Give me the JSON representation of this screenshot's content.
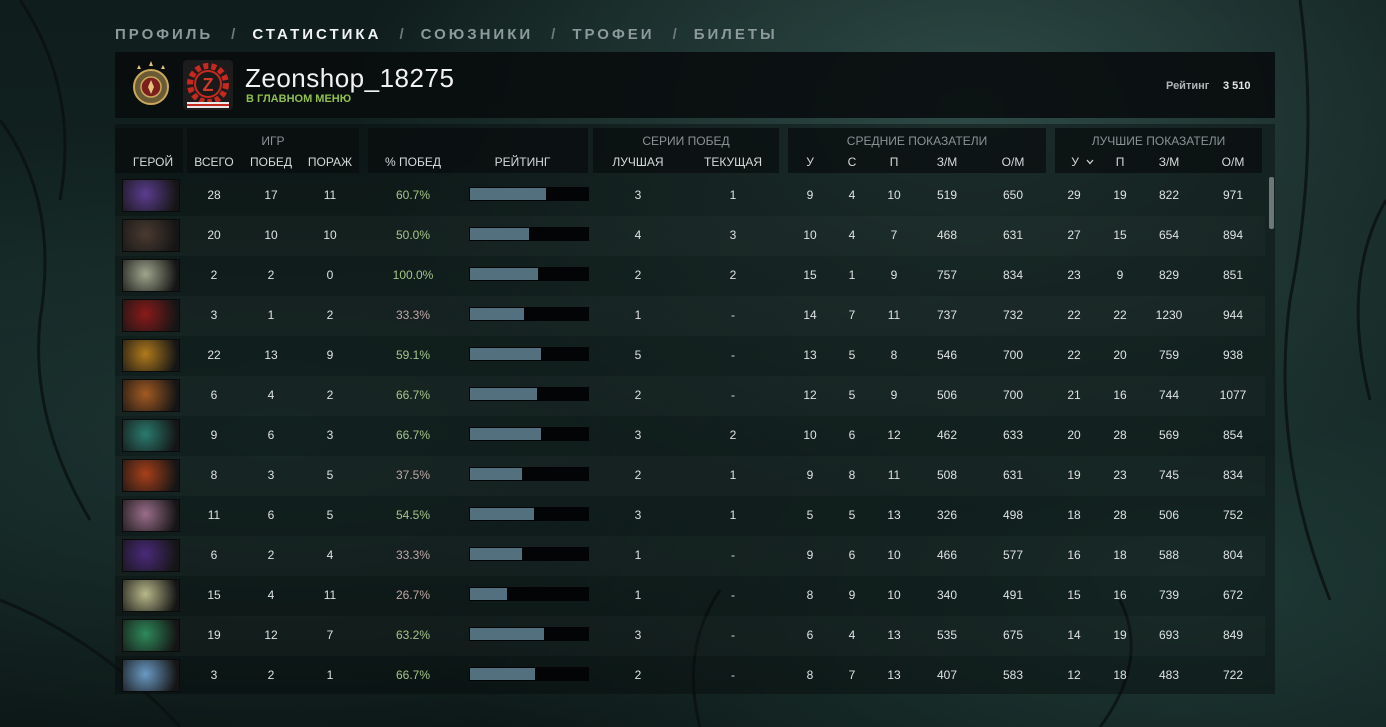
{
  "nav": {
    "tabs": [
      "ПРОФИЛЬ",
      "СТАТИСТИКА",
      "СОЮЗНИКИ",
      "ТРОФЕИ",
      "БИЛЕТЫ"
    ],
    "active": "СТАТИСТИКА",
    "separator": "/"
  },
  "profile": {
    "name": "Zeonshop_18275",
    "status": "В ГЛАВНОМ МЕНЮ",
    "rating_label": "Рейтинг",
    "rating_value": "3 510",
    "avatar_letter": "Z"
  },
  "table": {
    "groups": {
      "games": "ИГР",
      "streaks": "СЕРИИ ПОБЕД",
      "avg": "СРЕДНИЕ ПОКАЗАТЕЛИ",
      "best": "ЛУЧШИЕ ПОКАЗАТЕЛИ"
    },
    "columns": {
      "hero": "ГЕРОЙ",
      "total": "ВСЕГО",
      "wins": "ПОБЕД",
      "losses": "ПОРАЖ",
      "winrate": "% ПОБЕД",
      "rating": "РЕЙТИНГ",
      "best_streak": "ЛУЧШАЯ",
      "cur_streak": "ТЕКУЩАЯ",
      "avg_k": "У",
      "avg_d": "С",
      "avg_a": "П",
      "avg_gpm": "З/М",
      "avg_xpm": "О/М",
      "best_k": "У",
      "best_a": "П",
      "best_gpm": "З/М",
      "best_xpm": "О/М"
    },
    "sort_icon": "chevron-down-icon",
    "rows": [
      {
        "hero": "faceless-purple",
        "total": "28",
        "wins": "17",
        "losses": "11",
        "winrate": "60.7%",
        "rating_pct": 0.64,
        "best_streak": "3",
        "cur_streak": "1",
        "avg_k": "9",
        "avg_d": "4",
        "avg_a": "10",
        "avg_gpm": "519",
        "avg_xpm": "650",
        "best_k": "29",
        "best_a": "19",
        "best_gpm": "822",
        "best_xpm": "971"
      },
      {
        "hero": "beast-brown",
        "total": "20",
        "wins": "10",
        "losses": "10",
        "winrate": "50.0%",
        "rating_pct": 0.5,
        "best_streak": "4",
        "cur_streak": "3",
        "avg_k": "10",
        "avg_d": "4",
        "avg_a": "7",
        "avg_gpm": "468",
        "avg_xpm": "631",
        "best_k": "27",
        "best_a": "15",
        "best_gpm": "654",
        "best_xpm": "894"
      },
      {
        "hero": "pale-blade",
        "total": "2",
        "wins": "2",
        "losses": "0",
        "winrate": "100.0%",
        "rating_pct": 0.58,
        "best_streak": "2",
        "cur_streak": "2",
        "avg_k": "15",
        "avg_d": "1",
        "avg_a": "9",
        "avg_gpm": "757",
        "avg_xpm": "834",
        "best_k": "23",
        "best_a": "9",
        "best_gpm": "829",
        "best_xpm": "851"
      },
      {
        "hero": "red-queen",
        "total": "3",
        "wins": "1",
        "losses": "2",
        "winrate": "33.3%",
        "rating_pct": 0.46,
        "best_streak": "1",
        "cur_streak": "-",
        "avg_k": "14",
        "avg_d": "7",
        "avg_a": "11",
        "avg_gpm": "737",
        "avg_xpm": "732",
        "best_k": "22",
        "best_a": "22",
        "best_gpm": "1230",
        "best_xpm": "944"
      },
      {
        "hero": "golden-king",
        "total": "22",
        "wins": "13",
        "losses": "9",
        "winrate": "59.1%",
        "rating_pct": 0.6,
        "best_streak": "5",
        "cur_streak": "-",
        "avg_k": "13",
        "avg_d": "5",
        "avg_a": "8",
        "avg_gpm": "546",
        "avg_xpm": "700",
        "best_k": "22",
        "best_a": "20",
        "best_gpm": "759",
        "best_xpm": "938"
      },
      {
        "hero": "monkey-gold",
        "total": "6",
        "wins": "4",
        "losses": "2",
        "winrate": "66.7%",
        "rating_pct": 0.57,
        "best_streak": "2",
        "cur_streak": "-",
        "avg_k": "12",
        "avg_d": "5",
        "avg_a": "9",
        "avg_gpm": "506",
        "avg_xpm": "700",
        "best_k": "21",
        "best_a": "16",
        "best_gpm": "744",
        "best_xpm": "1077"
      },
      {
        "hero": "teal-warrior",
        "total": "9",
        "wins": "6",
        "losses": "3",
        "winrate": "66.7%",
        "rating_pct": 0.6,
        "best_streak": "3",
        "cur_streak": "2",
        "avg_k": "10",
        "avg_d": "6",
        "avg_a": "12",
        "avg_gpm": "462",
        "avg_xpm": "633",
        "best_k": "20",
        "best_a": "28",
        "best_gpm": "569",
        "best_xpm": "854"
      },
      {
        "hero": "ember-orange",
        "total": "8",
        "wins": "3",
        "losses": "5",
        "winrate": "37.5%",
        "rating_pct": 0.44,
        "best_streak": "2",
        "cur_streak": "1",
        "avg_k": "9",
        "avg_d": "8",
        "avg_a": "11",
        "avg_gpm": "508",
        "avg_xpm": "631",
        "best_k": "19",
        "best_a": "23",
        "best_gpm": "745",
        "best_xpm": "834"
      },
      {
        "hero": "violet-invoker",
        "total": "11",
        "wins": "6",
        "losses": "5",
        "winrate": "54.5%",
        "rating_pct": 0.54,
        "best_streak": "3",
        "cur_streak": "1",
        "avg_k": "5",
        "avg_d": "5",
        "avg_a": "13",
        "avg_gpm": "326",
        "avg_xpm": "498",
        "best_k": "18",
        "best_a": "28",
        "best_gpm": "506",
        "best_xpm": "752"
      },
      {
        "hero": "void-purple",
        "total": "6",
        "wins": "2",
        "losses": "4",
        "winrate": "33.3%",
        "rating_pct": 0.44,
        "best_streak": "1",
        "cur_streak": "-",
        "avg_k": "9",
        "avg_d": "6",
        "avg_a": "10",
        "avg_gpm": "466",
        "avg_xpm": "577",
        "best_k": "16",
        "best_a": "18",
        "best_gpm": "588",
        "best_xpm": "804"
      },
      {
        "hero": "sky-light",
        "total": "15",
        "wins": "4",
        "losses": "11",
        "winrate": "26.7%",
        "rating_pct": 0.31,
        "best_streak": "1",
        "cur_streak": "-",
        "avg_k": "8",
        "avg_d": "9",
        "avg_a": "10",
        "avg_gpm": "340",
        "avg_xpm": "491",
        "best_k": "15",
        "best_a": "16",
        "best_gpm": "739",
        "best_xpm": "672"
      },
      {
        "hero": "jade-spirit",
        "total": "19",
        "wins": "12",
        "losses": "7",
        "winrate": "63.2%",
        "rating_pct": 0.63,
        "best_streak": "3",
        "cur_streak": "-",
        "avg_k": "6",
        "avg_d": "4",
        "avg_a": "13",
        "avg_gpm": "535",
        "avg_xpm": "675",
        "best_k": "14",
        "best_a": "19",
        "best_gpm": "693",
        "best_xpm": "849"
      },
      {
        "hero": "frost-zeus",
        "total": "3",
        "wins": "2",
        "losses": "1",
        "winrate": "66.7%",
        "rating_pct": 0.55,
        "best_streak": "2",
        "cur_streak": "-",
        "avg_k": "8",
        "avg_d": "7",
        "avg_a": "13",
        "avg_gpm": "407",
        "avg_xpm": "583",
        "best_k": "12",
        "best_a": "18",
        "best_gpm": "483",
        "best_xpm": "722"
      }
    ],
    "hero_colors": [
      "#5c3d8f",
      "#4a3a30",
      "#9fa58c",
      "#8a1a1a",
      "#b07a1c",
      "#a35a22",
      "#2a7a6e",
      "#a8401a",
      "#9a6d8a",
      "#4a2a7a",
      "#b8b88a",
      "#2e8a5a",
      "#6a9ac4"
    ]
  }
}
